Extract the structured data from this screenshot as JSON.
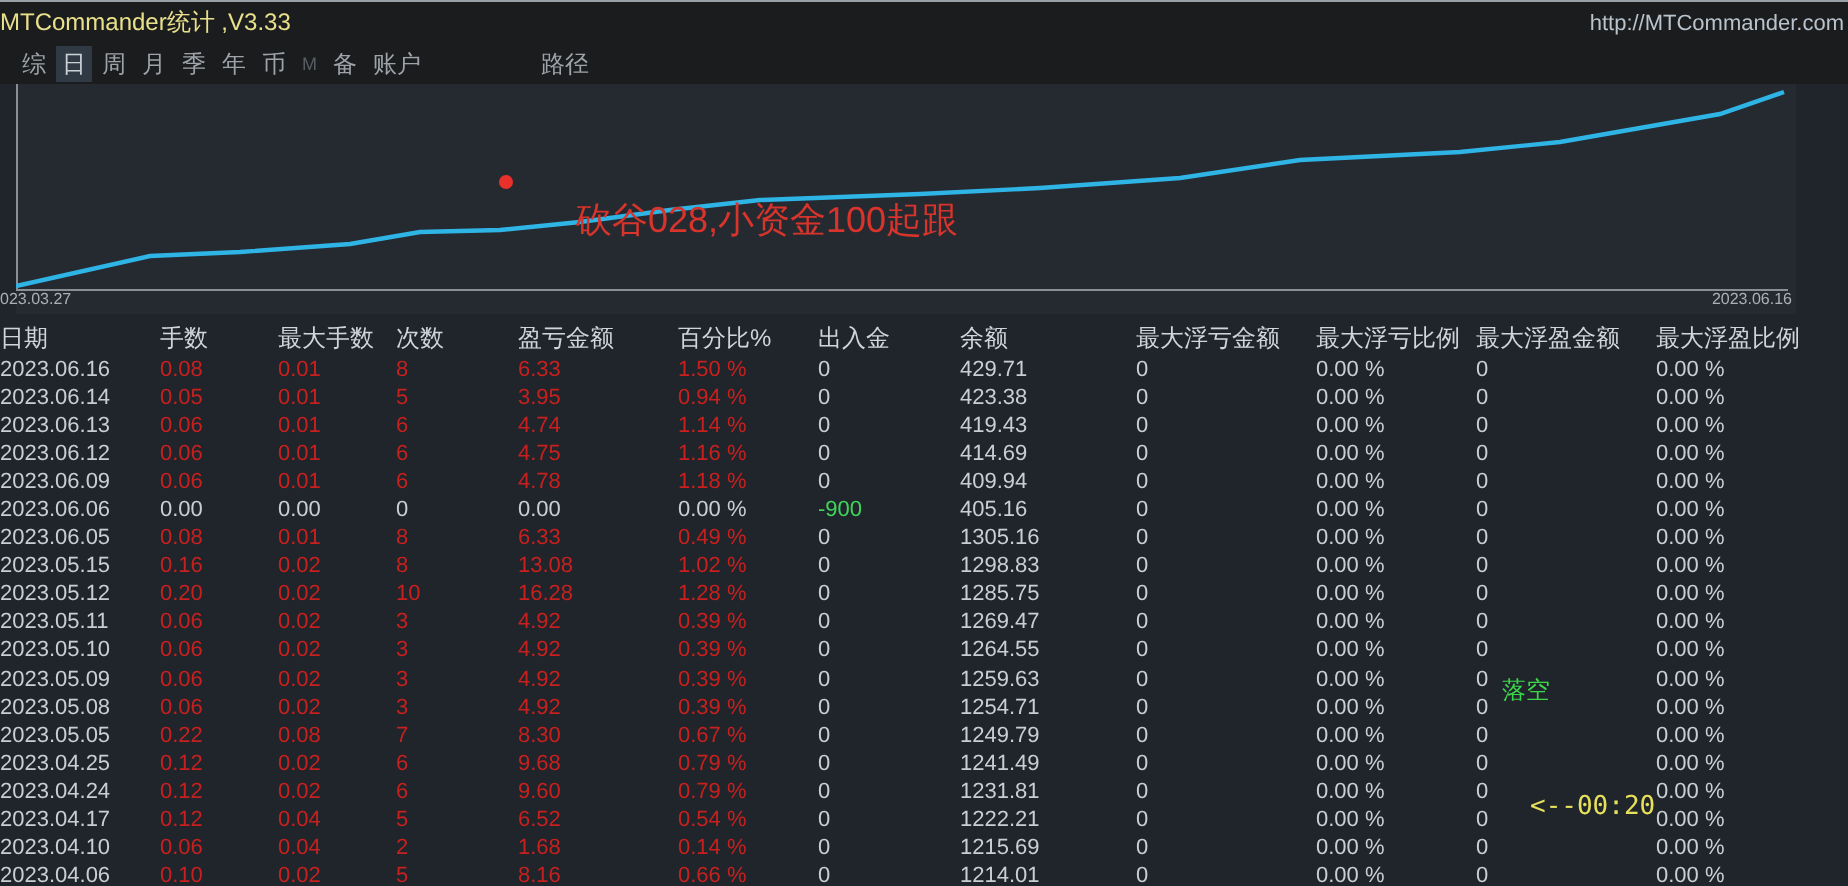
{
  "window": {
    "title": "MTCommander统计 ,V3.33",
    "url": "http://MTCommander.com"
  },
  "tabs": [
    {
      "label": "综",
      "selected": false,
      "disabled": false
    },
    {
      "label": "日",
      "selected": true,
      "disabled": false
    },
    {
      "label": "周",
      "selected": false,
      "disabled": false
    },
    {
      "label": "月",
      "selected": false,
      "disabled": false
    },
    {
      "label": "季",
      "selected": false,
      "disabled": false
    },
    {
      "label": "年",
      "selected": false,
      "disabled": false
    },
    {
      "label": "币",
      "selected": false,
      "disabled": false
    },
    {
      "label": "M",
      "selected": false,
      "disabled": true
    },
    {
      "label": "备",
      "selected": false,
      "disabled": false
    },
    {
      "label": "账户",
      "selected": false,
      "disabled": false
    }
  ],
  "path_tab": {
    "label": "路径",
    "selected": false
  },
  "chart": {
    "start_date": "023.03.27",
    "end_date": "2023.06.16",
    "annotation": "砍谷028,小资金100起跟"
  },
  "table": {
    "columns": [
      "日期",
      "手数",
      "最大手数",
      "次数",
      "盈亏金额",
      "百分比%",
      "出入金",
      "余额",
      "最大浮亏金额",
      "最大浮亏比例",
      "最大浮盈金额",
      "最大浮盈比例"
    ],
    "rows": [
      {
        "cells": [
          "2023.06.16",
          "0.08",
          "0.01",
          "8",
          "6.33",
          "1.50 %",
          "0",
          "429.71",
          "0",
          "0.00 %",
          "0",
          "0.00 %"
        ],
        "profit": true,
        "withdrawal": false
      },
      {
        "cells": [
          "2023.06.14",
          "0.05",
          "0.01",
          "5",
          "3.95",
          "0.94 %",
          "0",
          "423.38",
          "0",
          "0.00 %",
          "0",
          "0.00 %"
        ],
        "profit": true,
        "withdrawal": false
      },
      {
        "cells": [
          "2023.06.13",
          "0.06",
          "0.01",
          "6",
          "4.74",
          "1.14 %",
          "0",
          "419.43",
          "0",
          "0.00 %",
          "0",
          "0.00 %"
        ],
        "profit": true,
        "withdrawal": false
      },
      {
        "cells": [
          "2023.06.12",
          "0.06",
          "0.01",
          "6",
          "4.75",
          "1.16 %",
          "0",
          "414.69",
          "0",
          "0.00 %",
          "0",
          "0.00 %"
        ],
        "profit": true,
        "withdrawal": false
      },
      {
        "cells": [
          "2023.06.09",
          "0.06",
          "0.01",
          "6",
          "4.78",
          "1.18 %",
          "0",
          "409.94",
          "0",
          "0.00 %",
          "0",
          "0.00 %"
        ],
        "profit": true,
        "withdrawal": false
      },
      {
        "cells": [
          "2023.06.06",
          "0.00",
          "0.00",
          "0",
          "0.00",
          "0.00 %",
          "-900",
          "405.16",
          "0",
          "0.00 %",
          "0",
          "0.00 %"
        ],
        "profit": false,
        "withdrawal": true
      },
      {
        "cells": [
          "2023.06.05",
          "0.08",
          "0.01",
          "8",
          "6.33",
          "0.49 %",
          "0",
          "1305.16",
          "0",
          "0.00 %",
          "0",
          "0.00 %"
        ],
        "profit": true,
        "withdrawal": false
      },
      {
        "cells": [
          "2023.05.15",
          "0.16",
          "0.02",
          "8",
          "13.08",
          "1.02 %",
          "0",
          "1298.83",
          "0",
          "0.00 %",
          "0",
          "0.00 %"
        ],
        "profit": true,
        "withdrawal": false
      },
      {
        "cells": [
          "2023.05.12",
          "0.20",
          "0.02",
          "10",
          "16.28",
          "1.28 %",
          "0",
          "1285.75",
          "0",
          "0.00 %",
          "0",
          "0.00 %"
        ],
        "profit": true,
        "withdrawal": false
      },
      {
        "cells": [
          "2023.05.11",
          "0.06",
          "0.02",
          "3",
          "4.92",
          "0.39 %",
          "0",
          "1269.47",
          "0",
          "0.00 %",
          "0",
          "0.00 %"
        ],
        "profit": true,
        "withdrawal": false
      },
      {
        "cells": [
          "2023.05.10",
          "0.06",
          "0.02",
          "3",
          "4.92",
          "0.39 %",
          "0",
          "1264.55",
          "0",
          "0.00 %",
          "0",
          "0.00 %"
        ],
        "profit": true,
        "withdrawal": false
      },
      {
        "cells": [
          "2023.05.09",
          "0.06",
          "0.02",
          "3",
          "4.92",
          "0.39 %",
          "0",
          "1259.63",
          "0",
          "0.00 %",
          "0",
          "0.00 %"
        ],
        "profit": true,
        "withdrawal": false
      },
      {
        "cells": [
          "2023.05.08",
          "0.06",
          "0.02",
          "3",
          "4.92",
          "0.39 %",
          "0",
          "1254.71",
          "0",
          "0.00 %",
          "0",
          "0.00 %"
        ],
        "profit": true,
        "withdrawal": false
      },
      {
        "cells": [
          "2023.05.05",
          "0.22",
          "0.08",
          "7",
          "8.30",
          "0.67 %",
          "0",
          "1249.79",
          "0",
          "0.00 %",
          "0",
          "0.00 %"
        ],
        "profit": true,
        "withdrawal": false
      },
      {
        "cells": [
          "2023.04.25",
          "0.12",
          "0.02",
          "6",
          "9.68",
          "0.79 %",
          "0",
          "1241.49",
          "0",
          "0.00 %",
          "0",
          "0.00 %"
        ],
        "profit": true,
        "withdrawal": false
      },
      {
        "cells": [
          "2023.04.24",
          "0.12",
          "0.02",
          "6",
          "9.60",
          "0.79 %",
          "0",
          "1231.81",
          "0",
          "0.00 %",
          "0",
          "0.00 %"
        ],
        "profit": true,
        "withdrawal": false
      },
      {
        "cells": [
          "2023.04.17",
          "0.12",
          "0.04",
          "5",
          "6.52",
          "0.54 %",
          "0",
          "1222.21",
          "0",
          "0.00 %",
          "0",
          "0.00 %"
        ],
        "profit": true,
        "withdrawal": false
      },
      {
        "cells": [
          "2023.04.10",
          "0.06",
          "0.04",
          "2",
          "1.68",
          "0.14 %",
          "0",
          "1215.69",
          "0",
          "0.00 %",
          "0",
          "0.00 %"
        ],
        "profit": true,
        "withdrawal": false
      },
      {
        "cells": [
          "2023.04.06",
          "0.10",
          "0.02",
          "5",
          "8.16",
          "0.66 %",
          "0",
          "1214.01",
          "0",
          "0.00 %",
          "0",
          "0.00 %"
        ],
        "profit": true,
        "withdrawal": false
      }
    ]
  },
  "overlays": [
    {
      "kind": "status",
      "text": "落空"
    },
    {
      "kind": "timer",
      "text": "<--00:20"
    }
  ]
}
